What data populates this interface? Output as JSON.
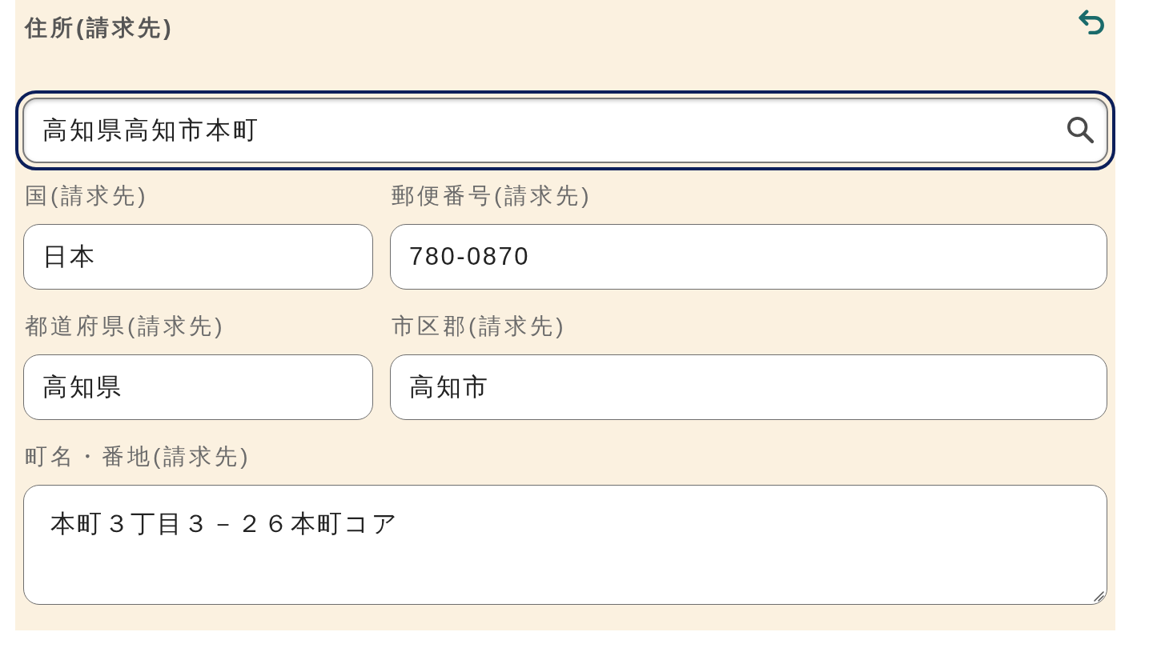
{
  "section": {
    "title": "住所(請求先)"
  },
  "search": {
    "value": "高知県高知市本町",
    "focused": true
  },
  "fields": [
    {
      "kind": "text",
      "label": "国(請求先)",
      "value": "日本"
    },
    {
      "kind": "text",
      "label": "郵便番号(請求先)",
      "value": "780-0870"
    },
    {
      "kind": "text",
      "label": "都道府県(請求先)",
      "value": "高知県"
    },
    {
      "kind": "text",
      "label": "市区郡(請求先)",
      "value": "高知市"
    },
    {
      "kind": "textarea",
      "label": "町名・番地(請求先)",
      "value": "本町３丁目３－２６本町コア"
    }
  ]
}
